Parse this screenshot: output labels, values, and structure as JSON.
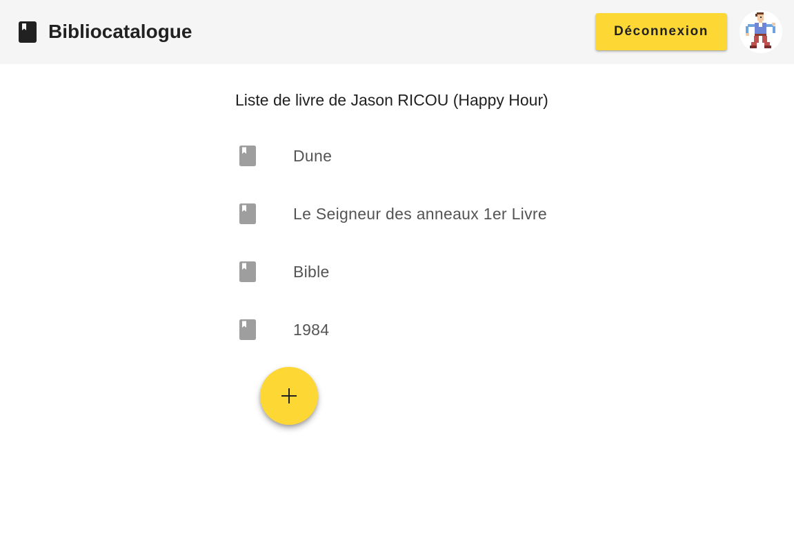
{
  "header": {
    "title": "Bibliocatalogue",
    "brand_icon": "book-icon",
    "logout_label": "Déconnexion",
    "avatar": "pixel-character-avatar"
  },
  "main": {
    "list_title": "Liste de livre de Jason RICOU (Happy Hour)",
    "books": [
      {
        "title": "Dune",
        "icon": "book-icon"
      },
      {
        "title": "Le Seigneur des anneaux 1er Livre",
        "icon": "book-icon"
      },
      {
        "title": "Bible",
        "icon": "book-icon"
      },
      {
        "title": "1984",
        "icon": "book-icon"
      }
    ],
    "add_button_icon": "plus-icon"
  },
  "colors": {
    "appbar_background": "#f5f5f5",
    "accent_yellow": "#fdd835",
    "title_text": "#212121",
    "list_text": "#545454",
    "list_icon": "#9e9e9e"
  }
}
